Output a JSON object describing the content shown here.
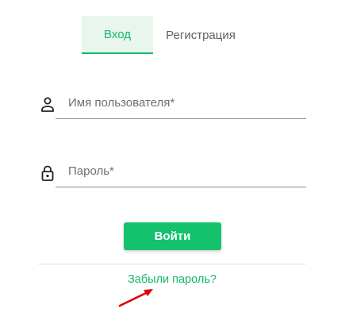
{
  "tabs": {
    "login_label": "Вход",
    "register_label": "Регистрация"
  },
  "form": {
    "username_placeholder": "Имя пользователя*",
    "username_value": "",
    "password_placeholder": "Пароль*",
    "password_value": "",
    "login_button_label": "Войти"
  },
  "links": {
    "forgot_password": "Забыли пароль?"
  },
  "icons": {
    "username": "user-icon",
    "password": "lock-icon",
    "annotation": "red-arrow-icon"
  },
  "colors": {
    "accent": "#14c26e",
    "accent_text": "#12b868",
    "active_tab_background": "#e8f6ee",
    "annotation_arrow": "#e00000"
  }
}
